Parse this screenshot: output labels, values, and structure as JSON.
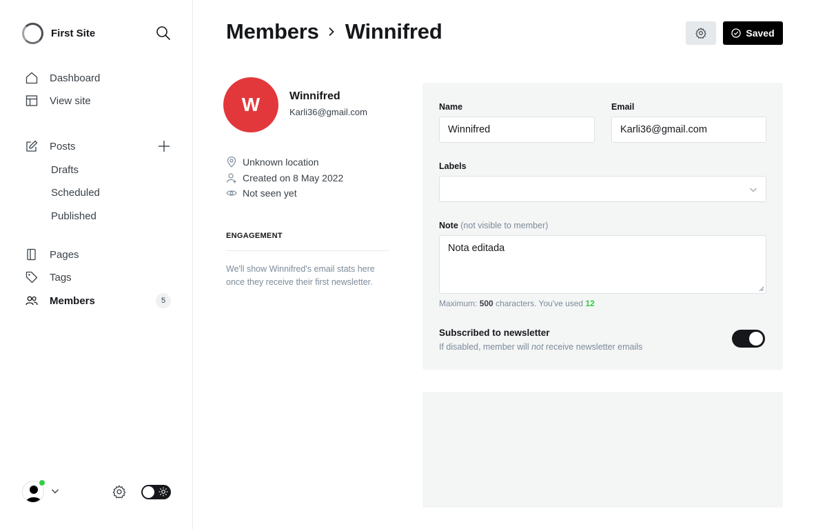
{
  "site": {
    "name": "First Site"
  },
  "nav": {
    "dashboard": "Dashboard",
    "view_site": "View site",
    "posts": "Posts",
    "drafts": "Drafts",
    "scheduled": "Scheduled",
    "published": "Published",
    "pages": "Pages",
    "tags": "Tags",
    "members": "Members",
    "members_count": "5"
  },
  "header": {
    "breadcrumb_parent": "Members",
    "breadcrumb_current": "Winnifred",
    "saved_label": "Saved"
  },
  "member": {
    "initial": "W",
    "name": "Winnifred",
    "email": "Karli36@gmail.com",
    "location": "Unknown location",
    "created": "Created on 8 May 2022",
    "seen": "Not seen yet"
  },
  "engagement": {
    "title": "ENGAGEMENT",
    "text": "We'll show Winnifred's email stats here once they receive their first newsletter."
  },
  "form": {
    "name_label": "Name",
    "name_value": "Winnifred",
    "email_label": "Email",
    "email_value": "Karli36@gmail.com",
    "labels_label": "Labels",
    "note_label": "Note",
    "note_muted": "(not visible to member)",
    "note_value": "Nota editada",
    "hint_prefix": "Maximum:",
    "hint_max": "500",
    "hint_middle": "characters. You've used",
    "hint_used": "12",
    "newsletter_title": "Subscribed to newsletter",
    "newsletter_desc_1": "If disabled, member will",
    "newsletter_desc_em": "not",
    "newsletter_desc_2": "receive newsletter emails",
    "newsletter_enabled": true
  },
  "colors": {
    "avatar_bg": "#e2383b",
    "accent_green": "#30cf43",
    "dark": "#15171a"
  }
}
